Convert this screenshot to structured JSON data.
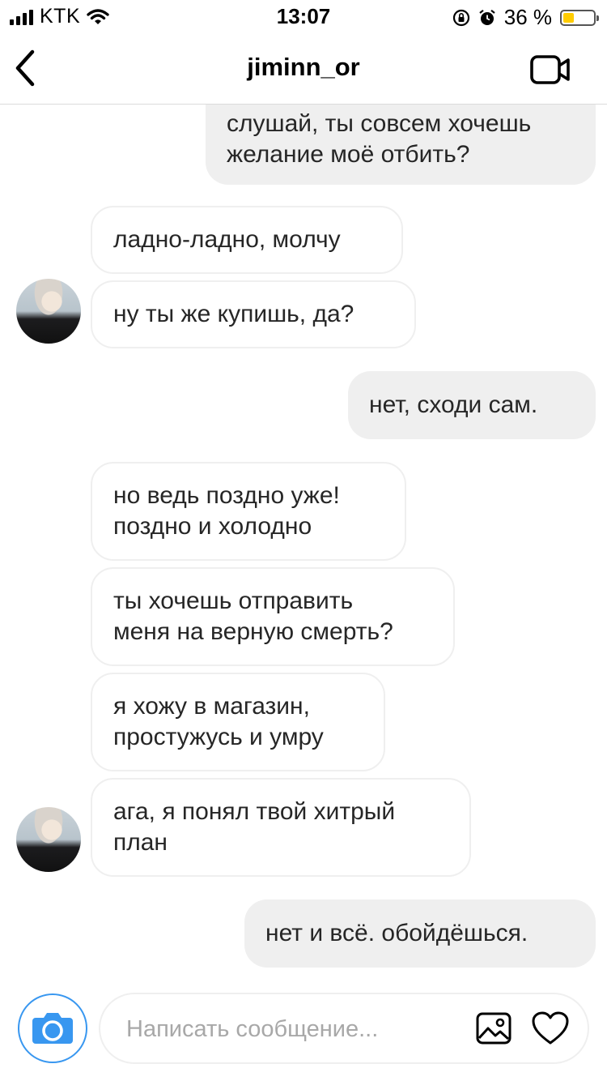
{
  "status": {
    "carrier": "KTK",
    "time": "13:07",
    "battery_text": "36 %",
    "battery_level": 0.36,
    "battery_color": "#ffcc00",
    "icons": [
      "signal-icon",
      "wifi-icon",
      "orientation-lock-icon",
      "alarm-icon",
      "battery-icon"
    ]
  },
  "header": {
    "title": "jiminn_or",
    "icons": [
      "chevron-left-icon",
      "video-camera-icon"
    ]
  },
  "messages": [
    {
      "side": "out",
      "text": "слушай, ты совсем хочешь\nжелание моё отбить?"
    },
    {
      "side": "in",
      "text": "ладно-ладно, молчу"
    },
    {
      "side": "in",
      "text": "ну ты же купишь, да?"
    },
    {
      "side": "out",
      "text": "нет, сходи сам."
    },
    {
      "side": "in",
      "text": "но ведь поздно уже!\nпоздно и холодно"
    },
    {
      "side": "in",
      "text": "ты хочешь отправить\nменя на верную смерть?"
    },
    {
      "side": "in",
      "text": "я хожу в магазин,\nпростужусь и умру"
    },
    {
      "side": "in",
      "text": "ага, я понял твой хитрый\nплан"
    },
    {
      "side": "out",
      "text": "нет и всё. обойдёшься."
    }
  ],
  "composer": {
    "placeholder": "Написать сообщение...",
    "icons": [
      "camera-icon",
      "gallery-icon",
      "heart-icon"
    ]
  },
  "colors": {
    "outgoing_bubble": "#efefef",
    "incoming_border": "#efefef",
    "accent": "#3897f0"
  }
}
